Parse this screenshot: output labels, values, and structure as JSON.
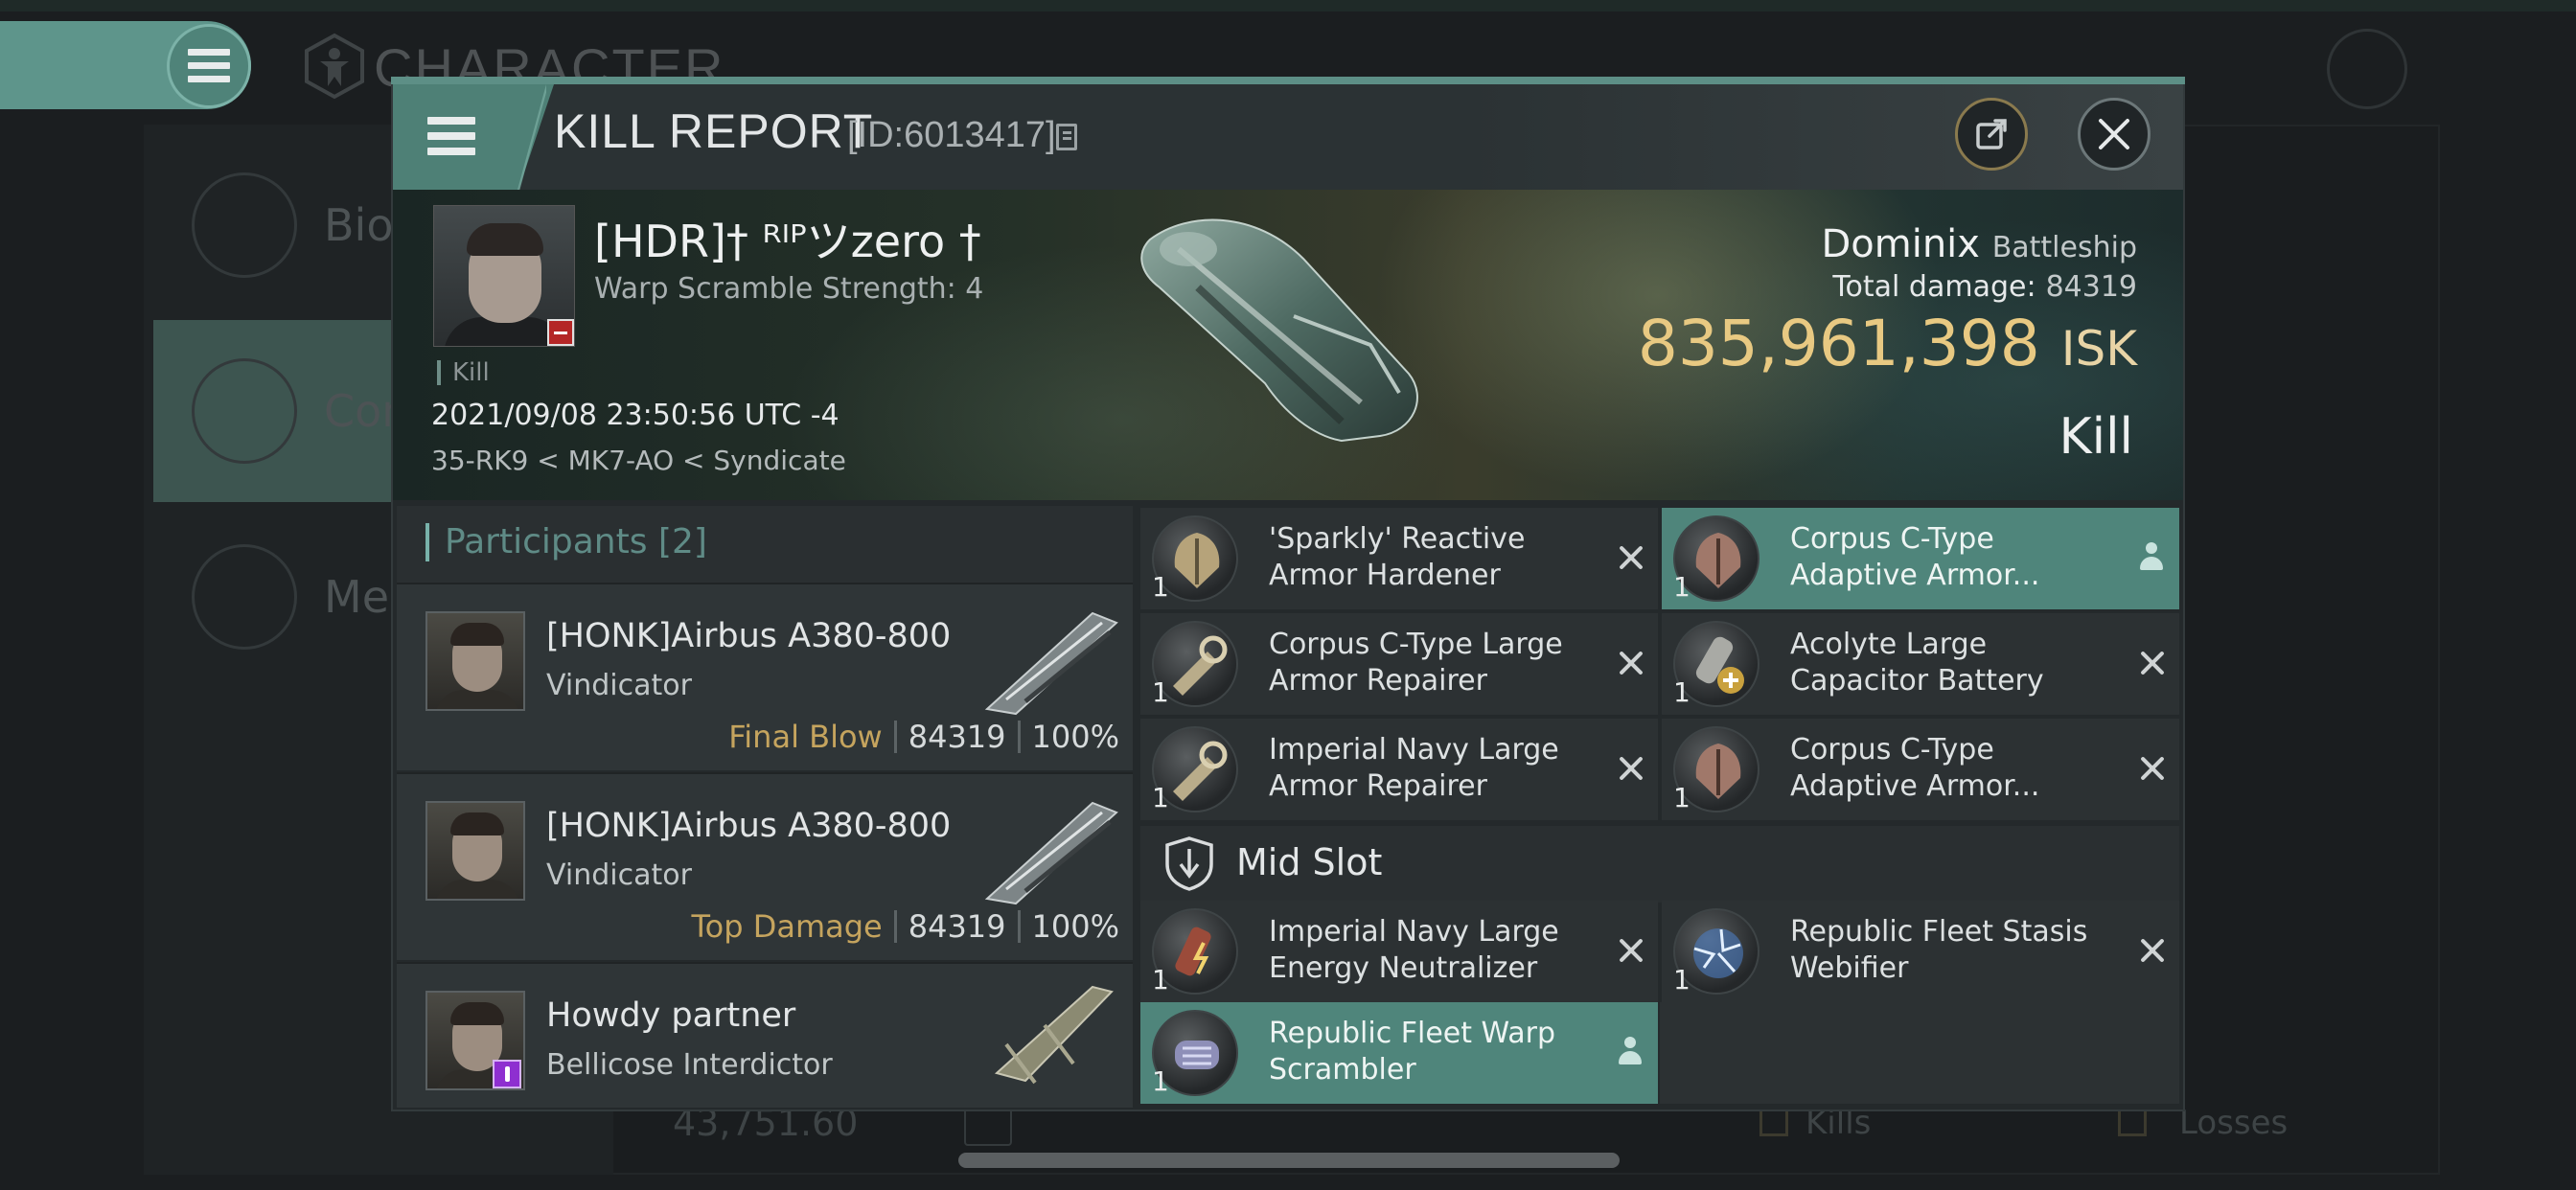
{
  "background": {
    "title": "CHARACTER",
    "side_items": [
      "Bio",
      "Com",
      "Med"
    ],
    "bottom_value": "43,751.60",
    "kills_label": "Kills",
    "losses_label": "Losses"
  },
  "header": {
    "title": "KILL REPORT",
    "id_text": "[ID:6013417]"
  },
  "victim": {
    "name": "[HDR]† ᴿᴵᴾツzero †",
    "warp_scramble": "Warp Scramble Strength: 4",
    "tag": "Kill",
    "datetime": "2021/09/08 23:50:56 UTC -4",
    "location": "35-RK9 < MK7-AO < Syndicate",
    "ship": "Dominix",
    "ship_class": "Battleship",
    "total_damage_label": "Total damage:",
    "total_damage": "84319",
    "isk_value": "835,961,398",
    "isk_unit": "ISK",
    "result": "Kill"
  },
  "participants": {
    "title": "Participants",
    "count": "[2]",
    "rows": [
      {
        "name": "[HONK]Airbus A380-800",
        "ship": "Vindicator",
        "tag": "Final Blow",
        "damage": "84319",
        "percent": "100%"
      },
      {
        "name": "[HONK]Airbus A380-800",
        "ship": "Vindicator",
        "tag": "Top Damage",
        "damage": "84319",
        "percent": "100%"
      },
      {
        "name": "Howdy partner",
        "ship": "Bellicose Interdictor"
      }
    ]
  },
  "fitting": {
    "low": [
      {
        "name": "'Sparkly' Reactive Armor Hardener",
        "qty": "1",
        "status": "destroyed"
      },
      {
        "name": "Corpus C-Type Adaptive Armor...",
        "qty": "1",
        "status": "dropped"
      },
      {
        "name": "Corpus C-Type Large Armor Repairer",
        "qty": "1",
        "status": "destroyed"
      },
      {
        "name": "Acolyte Large Capacitor Battery",
        "qty": "1",
        "status": "destroyed"
      },
      {
        "name": "Imperial Navy Large Armor Repairer",
        "qty": "1",
        "status": "destroyed"
      },
      {
        "name": "Corpus C-Type Adaptive Armor...",
        "qty": "1",
        "status": "destroyed"
      }
    ],
    "mid_title": "Mid Slot",
    "mid": [
      {
        "name": "Imperial Navy Large Energy Neutralizer",
        "qty": "1",
        "status": "destroyed"
      },
      {
        "name": "Republic Fleet Stasis Webifier",
        "qty": "1",
        "status": "destroyed"
      },
      {
        "name": "Republic Fleet Warp Scrambler",
        "qty": "1",
        "status": "dropped"
      }
    ]
  },
  "colors": {
    "accent_teal": "#4f857b",
    "isk_gold": "#e8c982",
    "tag_gold": "#c5a45e",
    "loss_badge_red": "#b42626",
    "role_badge_purple": "#8e2fd0"
  }
}
